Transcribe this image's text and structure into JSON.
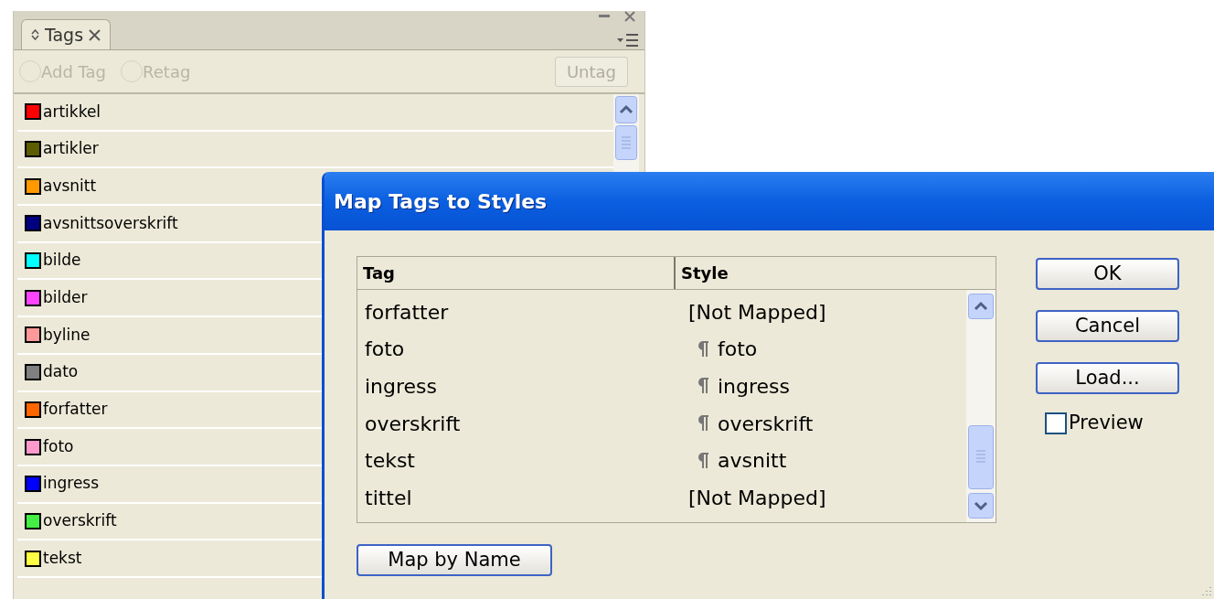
{
  "tags_panel": {
    "tab": {
      "label": "Tags",
      "selected": true
    },
    "toolbar": {
      "radios": [
        {
          "label": "Add Tag",
          "disabled": true
        },
        {
          "label": "Retag",
          "disabled": true
        }
      ],
      "untag_button": {
        "label": "Untag",
        "disabled": true
      }
    },
    "tags": [
      {
        "name": "artikkel",
        "color": "#ff0000"
      },
      {
        "name": "artikler",
        "color": "#5c5c00"
      },
      {
        "name": "avsnitt",
        "color": "#ff9900"
      },
      {
        "name": "avsnittsoverskrift",
        "color": "#000080"
      },
      {
        "name": "bilde",
        "color": "#00ffff"
      },
      {
        "name": "bilder",
        "color": "#ff44ff"
      },
      {
        "name": "byline",
        "color": "#ff9999"
      },
      {
        "name": "dato",
        "color": "#808080"
      },
      {
        "name": "forfatter",
        "color": "#ff6600"
      },
      {
        "name": "foto",
        "color": "#ff99cc"
      },
      {
        "name": "ingress",
        "color": "#0000ff"
      },
      {
        "name": "overskrift",
        "color": "#44ee44"
      },
      {
        "name": "tekst",
        "color": "#ffff44"
      }
    ]
  },
  "dialog": {
    "title": "Map Tags to Styles",
    "table": {
      "columns": [
        "Tag",
        "Style"
      ],
      "rows": [
        {
          "tag": "forfatter",
          "style": "[Not Mapped]",
          "kind": "unmapped"
        },
        {
          "tag": "foto",
          "style": "foto",
          "kind": "paragraph"
        },
        {
          "tag": "ingress",
          "style": "ingress",
          "kind": "paragraph"
        },
        {
          "tag": "overskrift",
          "style": "overskrift",
          "kind": "paragraph"
        },
        {
          "tag": "tekst",
          "style": "avsnitt",
          "kind": "paragraph"
        },
        {
          "tag": "tittel",
          "style": "[Not Mapped]",
          "kind": "unmapped"
        }
      ]
    },
    "buttons": [
      "OK",
      "Cancel",
      "Load..."
    ],
    "preview": {
      "label": "Preview",
      "checked": false
    },
    "map_by_name_button": "Map by Name"
  }
}
